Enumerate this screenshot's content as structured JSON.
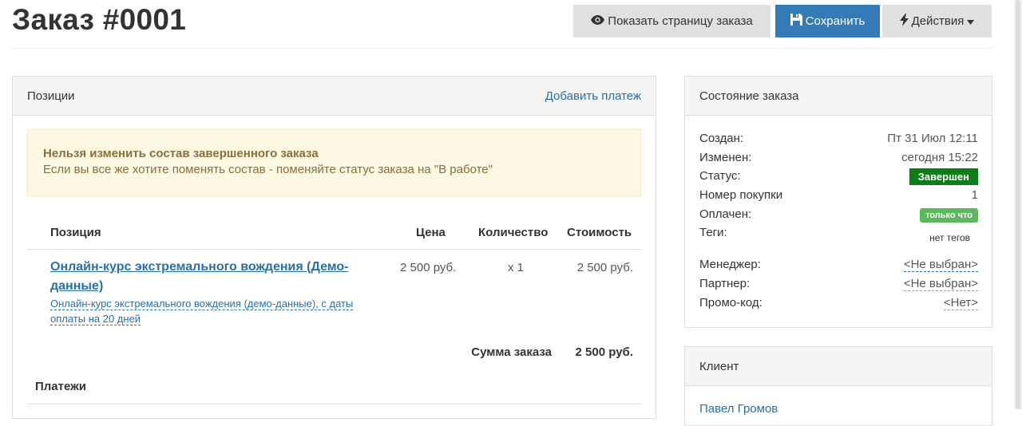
{
  "page": {
    "title": "Заказ #0001"
  },
  "toolbar": {
    "view_label": "Показать страницу заказа",
    "save_label": "Сохранить",
    "actions_label": "Действия"
  },
  "positions": {
    "heading": "Позиции",
    "add_payment": "Добавить платеж",
    "alert_title": "Нельзя изменить состав завершенного заказа",
    "alert_text": "Если вы все же хотите поменять состав - поменяйте статус заказа на \"В работе\"",
    "columns": [
      "Позиция",
      "Цена",
      "Количество",
      "Стоимость"
    ],
    "items": [
      {
        "name": "Онлайн-курс экстремального вождения (Демо-данные)",
        "description": "Онлайн-курс экстремального вождения (демо-данные), с даты оплаты на 20 дней",
        "price": "2 500 руб.",
        "quantity": "x 1",
        "cost": "2 500 руб."
      }
    ],
    "total_label": "Сумма заказа",
    "total_value": "2 500 руб.",
    "payments_title": "Платежи"
  },
  "status_panel": {
    "heading": "Состояние заказа",
    "created_label": "Создан:",
    "created_value": "Пт 31 Июл 12:11",
    "modified_label": "Изменен:",
    "modified_value": "сегодня 15:22",
    "status_label": "Статус:",
    "status_value": "Завершен",
    "purchase_label": "Номер покупки",
    "purchase_value": "1",
    "paid_label": "Оплачен:",
    "paid_value": "только что",
    "tags_label": "Теги:",
    "tags_value": "нет тегов",
    "manager_label": "Менеджер:",
    "manager_value": "<Не выбран>",
    "partner_label": "Партнер:",
    "partner_value": "<Не выбран>",
    "promo_label": "Промо-код:",
    "promo_value": "<Нет>"
  },
  "client_panel": {
    "heading": "Клиент",
    "name": "Павел Громов"
  },
  "colors": {
    "primary": "#337ab7",
    "link": "#2a6fa8",
    "status_done": "#0f7d17",
    "paid_badge": "#5cb85c",
    "alert_bg": "#fcf8e3"
  },
  "icons": {
    "view": "eye-icon",
    "save": "floppy-disk-icon",
    "actions": "bolt-icon",
    "dropdown": "caret-down-icon"
  }
}
